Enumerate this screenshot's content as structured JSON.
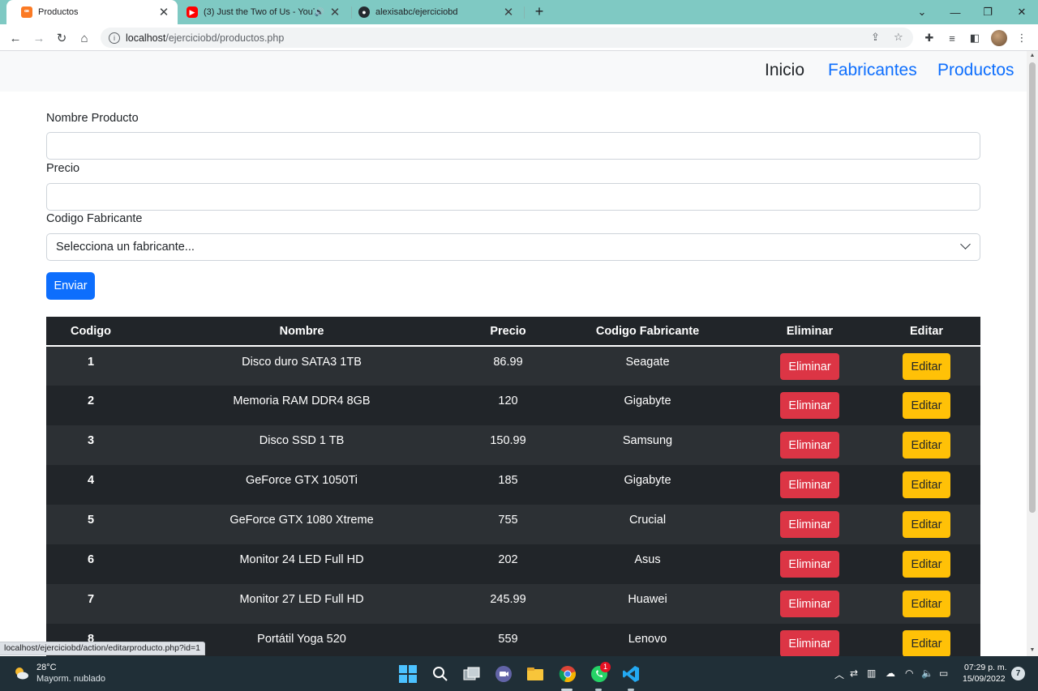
{
  "browser": {
    "tabs": [
      {
        "title": "Productos",
        "icon": "xampp-icon",
        "active": true
      },
      {
        "title": "(3) Just the Two of Us - YouT",
        "icon": "youtube-icon",
        "audio": true
      },
      {
        "title": "alexisabc/ejerciciobd",
        "icon": "github-icon"
      }
    ],
    "url_host": "localhost",
    "url_path": "/ejerciciobd/productos.php",
    "status_url": "localhost/ejerciciobd/action/editarproducto.php?id=1",
    "colors": {
      "tab_strip": "#7fc9c3"
    }
  },
  "nav": {
    "items": [
      "Inicio",
      "Fabricantes",
      "Productos"
    ]
  },
  "form": {
    "name_label": "Nombre Producto",
    "price_label": "Precio",
    "maker_label": "Codigo Fabricante",
    "maker_placeholder": "Selecciona un fabricante...",
    "submit_label": "Enviar"
  },
  "table": {
    "headers": [
      "Codigo",
      "Nombre",
      "Precio",
      "Codigo Fabricante",
      "Eliminar",
      "Editar"
    ],
    "delete_label": "Eliminar",
    "edit_label": "Editar",
    "rows": [
      {
        "code": "1",
        "name": "Disco duro SATA3 1TB",
        "price": "86.99",
        "maker": "Seagate"
      },
      {
        "code": "2",
        "name": "Memoria RAM DDR4 8GB",
        "price": "120",
        "maker": "Gigabyte"
      },
      {
        "code": "3",
        "name": "Disco SSD 1 TB",
        "price": "150.99",
        "maker": "Samsung"
      },
      {
        "code": "4",
        "name": "GeForce GTX 1050Ti",
        "price": "185",
        "maker": "Gigabyte"
      },
      {
        "code": "5",
        "name": "GeForce GTX 1080 Xtreme",
        "price": "755",
        "maker": "Crucial"
      },
      {
        "code": "6",
        "name": "Monitor 24 LED Full HD",
        "price": "202",
        "maker": "Asus"
      },
      {
        "code": "7",
        "name": "Monitor 27 LED Full HD",
        "price": "245.99",
        "maker": "Huawei"
      },
      {
        "code": "8",
        "name": "Portátil Yoga 520",
        "price": "559",
        "maker": "Lenovo"
      }
    ],
    "colors": {
      "delete": "#dc3545",
      "edit": "#ffc107",
      "header": "#212529"
    }
  },
  "taskbar": {
    "weather_temp": "28°C",
    "weather_desc": "Mayorm. nublado",
    "time": "07:29 p. m.",
    "date": "15/09/2022",
    "notifications": "7",
    "whatsapp_badge": "1"
  }
}
